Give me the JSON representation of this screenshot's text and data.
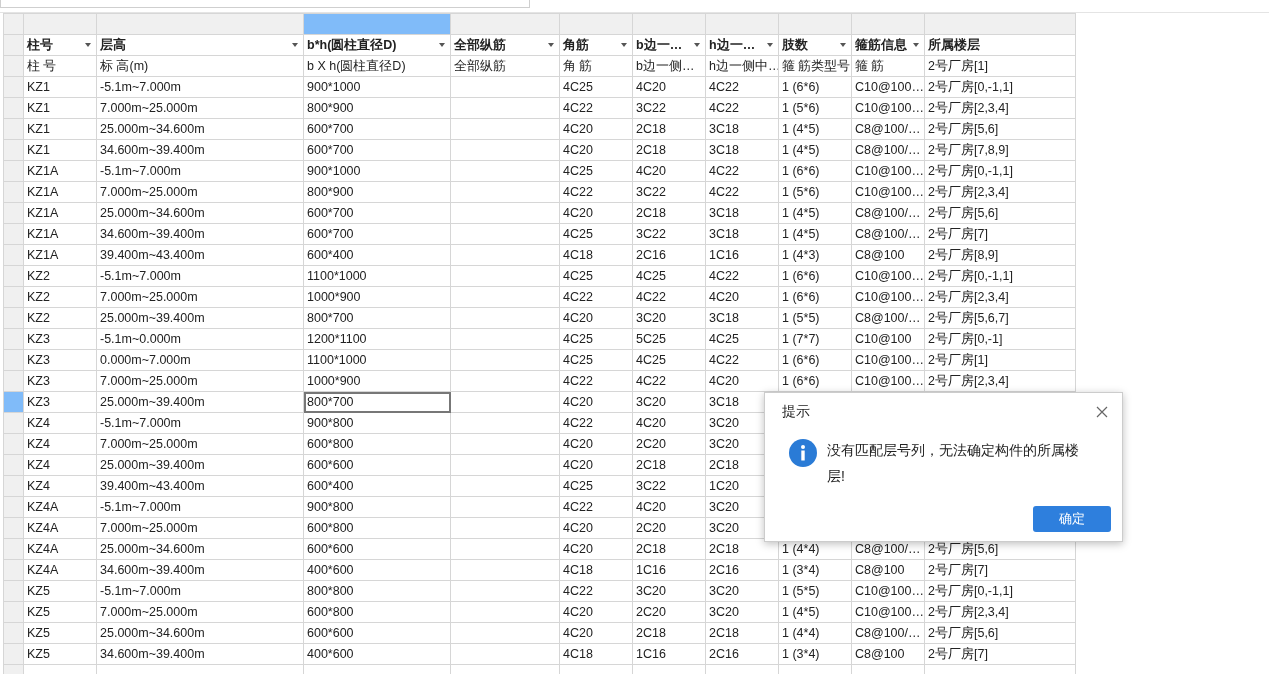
{
  "table": {
    "columns": [
      {
        "label": "柱号",
        "filter": true,
        "selected": false
      },
      {
        "label": "层高",
        "filter": true,
        "selected": false
      },
      {
        "label": "b*h(圆柱直径D)",
        "filter": true,
        "selected": true
      },
      {
        "label": "全部纵筋",
        "filter": true,
        "selected": false
      },
      {
        "label": "角筋",
        "filter": true,
        "selected": false
      },
      {
        "label": "b边一…",
        "filter": true,
        "selected": false
      },
      {
        "label": "h边一…",
        "filter": true,
        "selected": false
      },
      {
        "label": "肢数",
        "filter": true,
        "selected": false
      },
      {
        "label": "箍筋信息",
        "filter": true,
        "selected": false
      },
      {
        "label": "所属楼层",
        "filter": false,
        "selected": false
      }
    ],
    "subheader": [
      "柱 号",
      "标 高(m)",
      "b X h(圆柱直径D)",
      "全部纵筋",
      "角 筋",
      "b边一侧…",
      "h边一侧中…",
      "箍 筋类型号",
      "箍 筋",
      "2号厂房[1]"
    ],
    "rows": [
      {
        "selected": false,
        "cells": [
          "KZ1",
          "-5.1m~7.000m",
          "900*1000",
          null,
          "4C25",
          "4C20",
          "4C22",
          "1 (6*6)",
          "C10@100…",
          "2号厂房[0,-1,1]"
        ]
      },
      {
        "selected": false,
        "cells": [
          "KZ1",
          "7.000m~25.000m",
          "800*900",
          null,
          "4C22",
          "3C22",
          "4C22",
          "1 (5*6)",
          "C10@100…",
          "2号厂房[2,3,4]"
        ]
      },
      {
        "selected": false,
        "cells": [
          "KZ1",
          "25.000m~34.600m",
          "600*700",
          null,
          "4C20",
          "2C18",
          "3C18",
          "1 (4*5)",
          "C8@100/…",
          "2号厂房[5,6]"
        ]
      },
      {
        "selected": false,
        "cells": [
          "KZ1",
          "34.600m~39.400m",
          "600*700",
          null,
          "4C20",
          "2C18",
          "3C18",
          "1 (4*5)",
          "C8@100/…",
          "2号厂房[7,8,9]"
        ]
      },
      {
        "selected": false,
        "cells": [
          "KZ1A",
          "-5.1m~7.000m",
          "900*1000",
          null,
          "4C25",
          "4C20",
          "4C22",
          "1 (6*6)",
          "C10@100…",
          "2号厂房[0,-1,1]"
        ]
      },
      {
        "selected": false,
        "cells": [
          "KZ1A",
          "7.000m~25.000m",
          "800*900",
          null,
          "4C22",
          "3C22",
          "4C22",
          "1 (5*6)",
          "C10@100…",
          "2号厂房[2,3,4]"
        ]
      },
      {
        "selected": false,
        "cells": [
          "KZ1A",
          "25.000m~34.600m",
          "600*700",
          null,
          "4C20",
          "2C18",
          "3C18",
          "1 (4*5)",
          "C8@100/…",
          "2号厂房[5,6]"
        ]
      },
      {
        "selected": false,
        "cells": [
          "KZ1A",
          "34.600m~39.400m",
          "600*700",
          null,
          "4C25",
          "3C22",
          "3C18",
          "1 (4*5)",
          "C8@100/…",
          "2号厂房[7]"
        ]
      },
      {
        "selected": false,
        "cells": [
          "KZ1A",
          "39.400m~43.400m",
          "600*400",
          null,
          "4C18",
          "2C16",
          "1C16",
          "1 (4*3)",
          "C8@100",
          "2号厂房[8,9]"
        ]
      },
      {
        "selected": false,
        "cells": [
          "KZ2",
          "-5.1m~7.000m",
          "1100*1000",
          null,
          "4C25",
          "4C25",
          "4C22",
          "1 (6*6)",
          "C10@100…",
          "2号厂房[0,-1,1]"
        ]
      },
      {
        "selected": false,
        "cells": [
          "KZ2",
          "7.000m~25.000m",
          "1000*900",
          null,
          "4C22",
          "4C22",
          "4C20",
          "1 (6*6)",
          "C10@100…",
          "2号厂房[2,3,4]"
        ]
      },
      {
        "selected": false,
        "cells": [
          "KZ2",
          "25.000m~39.400m",
          "800*700",
          null,
          "4C20",
          "3C20",
          "3C18",
          "1 (5*5)",
          "C8@100/…",
          "2号厂房[5,6,7]"
        ]
      },
      {
        "selected": false,
        "cells": [
          "KZ3",
          "-5.1m~0.000m",
          "1200*1100",
          null,
          "4C25",
          "5C25",
          "4C25",
          "1 (7*7)",
          "C10@100",
          "2号厂房[0,-1]"
        ]
      },
      {
        "selected": false,
        "cells": [
          "KZ3",
          "0.000m~7.000m",
          "1100*1000",
          null,
          "4C25",
          "4C25",
          "4C22",
          "1 (6*6)",
          "C10@100…",
          "2号厂房[1]"
        ]
      },
      {
        "selected": false,
        "cells": [
          "KZ3",
          "7.000m~25.000m",
          "1000*900",
          null,
          "4C22",
          "4C22",
          "4C20",
          "1 (6*6)",
          "C10@100…",
          "2号厂房[2,3,4]"
        ]
      },
      {
        "selected": true,
        "cells": [
          "KZ3",
          "25.000m~39.400m",
          "800*700",
          null,
          "4C20",
          "3C20",
          "3C18",
          null,
          null,
          null
        ]
      },
      {
        "selected": false,
        "cells": [
          "KZ4",
          "-5.1m~7.000m",
          "900*800",
          null,
          "4C22",
          "4C20",
          "3C20",
          null,
          null,
          null
        ]
      },
      {
        "selected": false,
        "cells": [
          "KZ4",
          "7.000m~25.000m",
          "600*800",
          null,
          "4C20",
          "2C20",
          "3C20",
          null,
          null,
          null
        ]
      },
      {
        "selected": false,
        "cells": [
          "KZ4",
          "25.000m~39.400m",
          "600*600",
          null,
          "4C20",
          "2C18",
          "2C18",
          null,
          null,
          null
        ]
      },
      {
        "selected": false,
        "cells": [
          "KZ4",
          "39.400m~43.400m",
          "600*400",
          null,
          "4C25",
          "3C22",
          "1C20",
          null,
          null,
          null
        ]
      },
      {
        "selected": false,
        "cells": [
          "KZ4A",
          "-5.1m~7.000m",
          "900*800",
          null,
          "4C22",
          "4C20",
          "3C20",
          null,
          null,
          null
        ]
      },
      {
        "selected": false,
        "cells": [
          "KZ4A",
          "7.000m~25.000m",
          "600*800",
          null,
          "4C20",
          "2C20",
          "3C20",
          null,
          null,
          null
        ]
      },
      {
        "selected": false,
        "cells": [
          "KZ4A",
          "25.000m~34.600m",
          "600*600",
          null,
          "4C20",
          "2C18",
          "2C18",
          "1 (4*4)",
          "C8@100/…",
          "2号厂房[5,6]"
        ]
      },
      {
        "selected": false,
        "cells": [
          "KZ4A",
          "34.600m~39.400m",
          "400*600",
          null,
          "4C18",
          "1C16",
          "2C16",
          "1 (3*4)",
          "C8@100",
          "2号厂房[7]"
        ]
      },
      {
        "selected": false,
        "cells": [
          "KZ5",
          "-5.1m~7.000m",
          "800*800",
          null,
          "4C22",
          "3C20",
          "3C20",
          "1 (5*5)",
          "C10@100…",
          "2号厂房[0,-1,1]"
        ]
      },
      {
        "selected": false,
        "cells": [
          "KZ5",
          "7.000m~25.000m",
          "600*800",
          null,
          "4C20",
          "2C20",
          "3C20",
          "1 (4*5)",
          "C10@100…",
          "2号厂房[2,3,4]"
        ]
      },
      {
        "selected": false,
        "cells": [
          "KZ5",
          "25.000m~34.600m",
          "600*600",
          null,
          "4C20",
          "2C18",
          "2C18",
          "1 (4*4)",
          "C8@100/…",
          "2号厂房[5,6]"
        ]
      },
      {
        "selected": false,
        "cells": [
          "KZ5",
          "34.600m~39.400m",
          "400*600",
          null,
          "4C18",
          "1C16",
          "2C16",
          "1 (3*4)",
          "C8@100",
          "2号厂房[7]"
        ]
      }
    ]
  },
  "dialog": {
    "title": "提示",
    "message": "没有匹配层号列，无法确定构件的所属楼层!",
    "button": "确定"
  }
}
